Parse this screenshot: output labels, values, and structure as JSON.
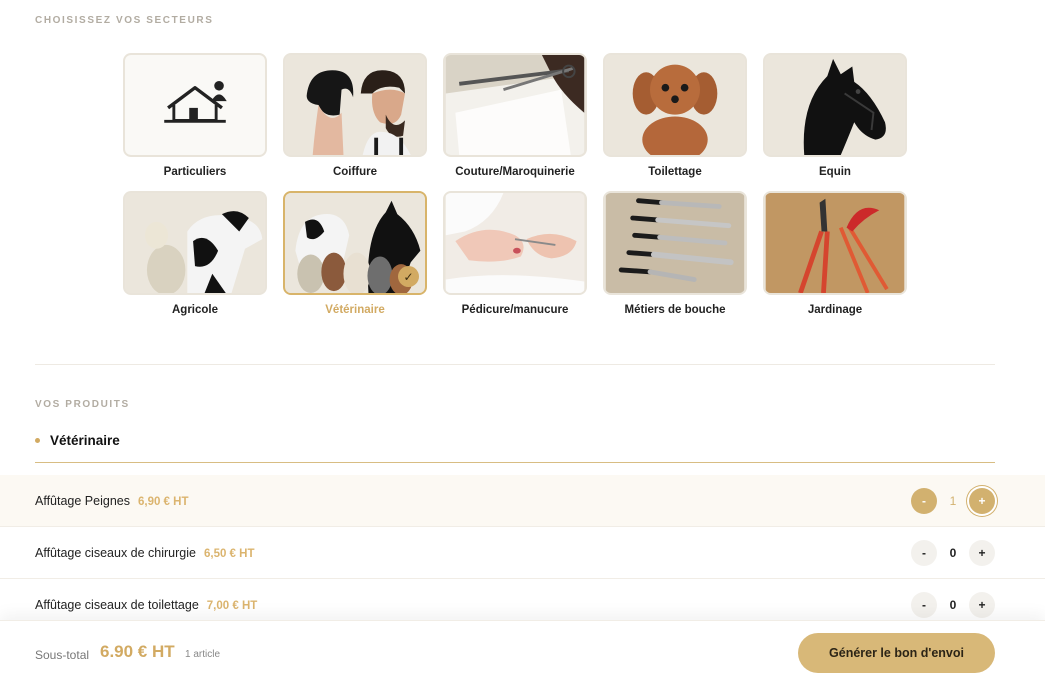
{
  "sectors_section": {
    "label": "CHOISISSEZ VOS SECTEURS",
    "items": [
      {
        "label": "Particuliers",
        "selected": false
      },
      {
        "label": "Coiffure",
        "selected": false
      },
      {
        "label": "Couture/Maroquinerie",
        "selected": false
      },
      {
        "label": "Toilettage",
        "selected": false
      },
      {
        "label": "Equin",
        "selected": false
      },
      {
        "label": "Agricole",
        "selected": false
      },
      {
        "label": "Vétérinaire",
        "selected": true
      },
      {
        "label": "Pédicure/manucure",
        "selected": false
      },
      {
        "label": "Métiers de bouche",
        "selected": false
      },
      {
        "label": "Jardinage",
        "selected": false
      }
    ],
    "check_glyph": "✓"
  },
  "products_section": {
    "label": "VOS PRODUITS",
    "group_title": "Vétérinaire",
    "items": [
      {
        "name": "Affûtage Peignes",
        "price": "6,90 € HT",
        "minus": "-",
        "qty": "1",
        "plus": "+"
      },
      {
        "name": "Affûtage ciseaux de chirurgie",
        "price": "6,50 € HT",
        "minus": "-",
        "qty": "0",
        "plus": "+"
      },
      {
        "name": "Affûtage ciseaux de toilettage",
        "price": "7,00 € HT",
        "minus": "-",
        "qty": "0",
        "plus": "+"
      }
    ]
  },
  "footer": {
    "subtotal_label": "Sous-total",
    "subtotal_value": "6.90 € HT",
    "article_count": "1 article",
    "cta_label": "Générer le bon d'envoi"
  },
  "colors": {
    "accent": "#d2aa62",
    "cta": "#d8b878",
    "tile_bg": "#ece7dd"
  }
}
